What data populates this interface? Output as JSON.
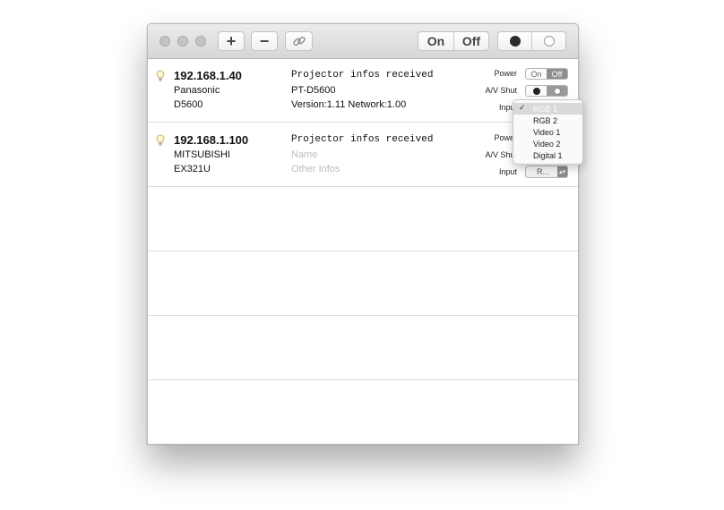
{
  "toolbar": {
    "add_label": "+",
    "remove_label": "−",
    "link_icon": "link-icon",
    "power_on_label": "On",
    "power_off_label": "Off",
    "shutter_close_icon": "black-circle-icon",
    "shutter_open_icon": "white-circle-icon"
  },
  "projectors": [
    {
      "ip": "192.168.1.40",
      "brand": "Panasonic",
      "model": "D5600",
      "status": "Projector infos received",
      "name": "PT-D5600",
      "other_infos": "Version:1.11 Network:1.00",
      "power_label": "Power",
      "power_on": "On",
      "power_off": "Off",
      "av_shut_label": "A/V Shut",
      "input_label": "Input"
    },
    {
      "ip": "192.168.1.100",
      "brand": "MITSUBISHI",
      "model": "EX321U",
      "status": "Projector infos received",
      "name_placeholder": "Name",
      "other_infos_placeholder": "Other Infos",
      "power_label": "Power",
      "av_shut_label": "A/V Shut",
      "input_label": "Input",
      "input_value": "R..."
    }
  ],
  "input_dropdown": {
    "check_mark": "✓",
    "options": [
      "RGB 1",
      "RGB 2",
      "Video 1",
      "Video 2",
      "Digital 1"
    ],
    "selected": "RGB 1"
  },
  "colors": {
    "toggle_active": "#8e8e8e",
    "row_divider": "#dcdcdc"
  }
}
